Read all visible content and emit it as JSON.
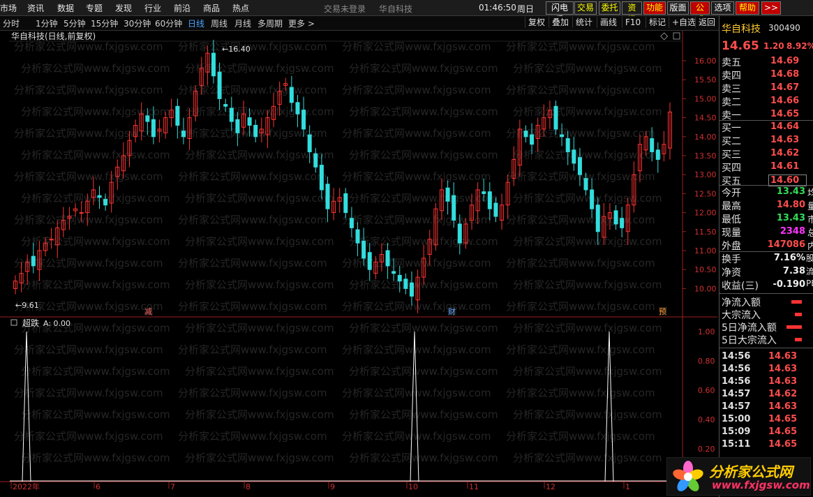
{
  "menu": {
    "items": [
      "市场",
      "资讯",
      "数据",
      "专题",
      "发现",
      "行业",
      "前沿",
      "商品",
      "热点"
    ],
    "status": "交易未登录",
    "stock_name": "华自科技",
    "clock": "01:46:50",
    "weekday": "周日",
    "buttons": [
      {
        "label": "闪电手",
        "color": "#ffffff",
        "bg": "#1c1c1c"
      },
      {
        "label": "交易",
        "color": "#ffff00",
        "bg": "#1c1c1c"
      },
      {
        "label": "委托",
        "color": "#ffff00",
        "bg": "#1c1c1c"
      },
      {
        "label": "资讯",
        "color": "#ffff00",
        "bg": "#1c1c1c"
      },
      {
        "label": "功能",
        "color": "#ffff00",
        "bg": "#c00000"
      },
      {
        "label": "版面",
        "color": "#ffffff",
        "bg": "#1c1c1c"
      },
      {
        "label": "公式",
        "color": "#ffff00",
        "bg": "#c00000"
      },
      {
        "label": "选项",
        "color": "#ffffff",
        "bg": "#1c1c1c"
      },
      {
        "label": "帮助",
        "color": "#ffff00",
        "bg": "#c00000"
      },
      {
        "label": ">>",
        "color": "#ffffff",
        "bg": "#c00000"
      }
    ]
  },
  "periods": [
    "分时",
    "1分钟",
    "5分钟",
    "15分钟",
    "30分钟",
    "60分钟",
    "日线",
    "周线",
    "月线",
    "多周期",
    "更多 >"
  ],
  "active_period": "日线",
  "toolbar_right": [
    "复权",
    "叠加",
    "统计",
    "画线",
    "F10",
    "标记",
    "+自选",
    "返回"
  ],
  "chart": {
    "title": "华自科技(日线,前复权)",
    "hi_label": "16.40",
    "lo_label": "9.61",
    "price_ticks": [
      "16.00",
      "15.50",
      "15.00",
      "14.50",
      "14.00",
      "13.50",
      "13.00",
      "12.50",
      "12.00",
      "11.50",
      "11.00",
      "10.50",
      "10.00"
    ],
    "markers": [
      {
        "label": "减",
        "color": "#ff6666"
      },
      {
        "label": "财",
        "color": "#66aaff"
      },
      {
        "label": "预",
        "color": "#ff9933"
      }
    ],
    "watermark": "分析家公式网www.fxjgsw.com"
  },
  "indicator": {
    "name": "超跌",
    "value_label": "A: 0.00",
    "ticks": [
      "1.00",
      "0.80",
      "0.60",
      "0.40",
      "0.20"
    ]
  },
  "xaxis": {
    "labels": [
      "2022年",
      "6",
      "7",
      "8",
      "9",
      "10",
      "11",
      "12",
      "1"
    ]
  },
  "quote": {
    "name": "华自科技",
    "code": "300490",
    "price": "14.65",
    "change": "1.20",
    "pct": "8.92%",
    "sells": [
      {
        "k": "卖五",
        "v": "14.69"
      },
      {
        "k": "卖四",
        "v": "14.68"
      },
      {
        "k": "卖三",
        "v": "14.67"
      },
      {
        "k": "卖二",
        "v": "14.66"
      },
      {
        "k": "卖一",
        "v": "14.65"
      }
    ],
    "buys": [
      {
        "k": "买一",
        "v": "14.64"
      },
      {
        "k": "买二",
        "v": "14.63"
      },
      {
        "k": "买三",
        "v": "14.62"
      },
      {
        "k": "买四",
        "v": "14.61"
      },
      {
        "k": "买五",
        "v": "14.60"
      }
    ],
    "stats": [
      {
        "k": "今开",
        "v": "13.43",
        "c": "green",
        "t": "均"
      },
      {
        "k": "最高",
        "v": "14.80",
        "c": "red",
        "t": "量"
      },
      {
        "k": "最低",
        "v": "13.43",
        "c": "green",
        "t": "市"
      },
      {
        "k": "现量",
        "v": "2348",
        "c": "magenta",
        "t": "总"
      },
      {
        "k": "外盘",
        "v": "147086",
        "c": "red",
        "t": "内"
      }
    ],
    "stats2": [
      {
        "k": "换手",
        "v": "7.16%",
        "t": "股"
      },
      {
        "k": "净资",
        "v": "7.38",
        "t": "流"
      },
      {
        "k": "收益(三)",
        "v": "-0.190",
        "t": "PE"
      }
    ],
    "flows": [
      "净流入额",
      "大宗流入",
      "5日净流入额",
      "5日大宗流入"
    ],
    "ticks": [
      {
        "t": "14:56",
        "p": "14.63"
      },
      {
        "t": "14:56",
        "p": "14.63"
      },
      {
        "t": "14:56",
        "p": "14.63"
      },
      {
        "t": "14:57",
        "p": "14.62"
      },
      {
        "t": "14:57",
        "p": "14.63"
      },
      {
        "t": "15:00",
        "p": "14.65"
      },
      {
        "t": "15:09",
        "p": "14.65"
      },
      {
        "t": "15:11",
        "p": "14.65"
      }
    ]
  },
  "logo": {
    "text": "分析家公式网",
    "url": "www.fxjgsw.com"
  }
}
